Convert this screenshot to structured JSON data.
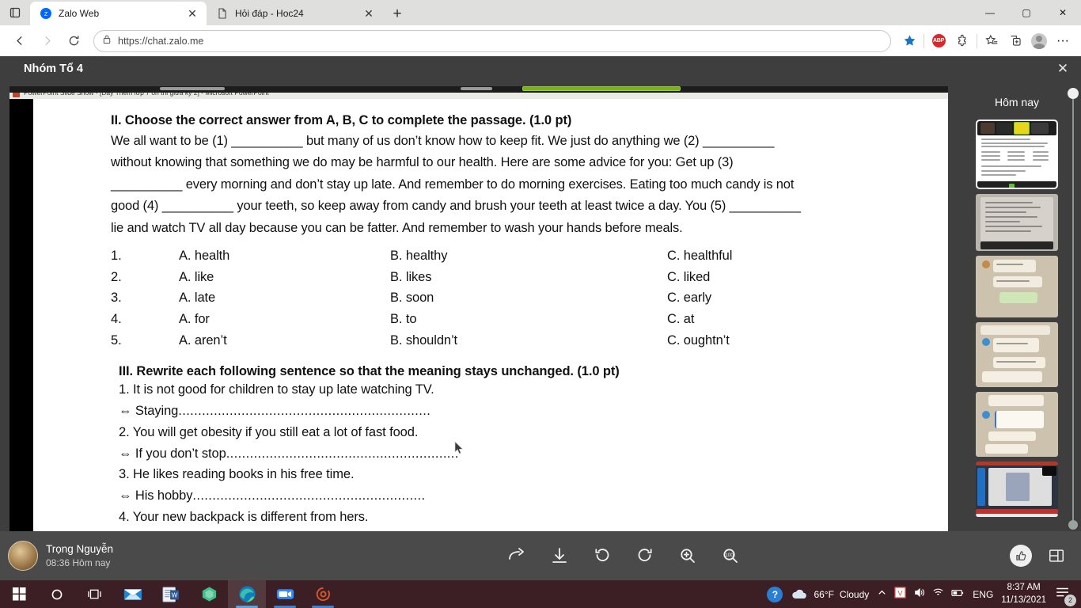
{
  "browser": {
    "tabs": [
      {
        "title": "Zalo Web",
        "favicon": "zalo-icon",
        "active": true
      },
      {
        "title": "Hỏi đáp - Hoc24",
        "favicon": "page-icon",
        "active": false
      }
    ],
    "new_tab_label": "+",
    "window_controls": {
      "minimize": "—",
      "maximize": "▢",
      "close": "✕"
    },
    "nav": {
      "back": "back-arrow",
      "forward": "forward-arrow",
      "reload": "reload-icon"
    },
    "address": {
      "url": "https://chat.zalo.me",
      "lock": "lock-icon"
    },
    "toolbar_icons": [
      "favorite-star-icon",
      "adblock-plus-icon",
      "extensions-icon",
      "collections-icon",
      "tab-collection-icon",
      "profile-avatar",
      "more-options-icon"
    ],
    "adblock_label": "ABP",
    "more_label": "···"
  },
  "viewer": {
    "title": "Nhóm Tổ 4",
    "close_label": "✕",
    "ppt_titlebar": "PowerPoint Slide Show - [Day Thêm lớp 7 ôn thi giữa kỳ 2] - Microsoft PowerPoint"
  },
  "slide": {
    "section2_heading": "II. Choose the correct answer from A, B, C to complete the passage. (1.0 pt)",
    "passage": [
      {
        "text": "We all want to be (1)",
        "blank": 100
      },
      {
        "text": "but many of us don’t know how to keep fit. We just do anything we (2)",
        "blank": 105
      },
      {
        "text": "without knowing that something we do may be harmful to our health. Here are some advice for you: Get up (3)",
        "blank": 0
      },
      {
        "text": "",
        "blank": 100
      },
      {
        "text": "every morning and don’t stay up late. And remember to do morning exercises. Eating too much candy is not good (4)",
        "blank": 95
      },
      {
        "text": "your teeth, so keep away from candy and brush your teeth at least twice a day. You (5)",
        "blank": 105
      },
      {
        "text": "lie and watch TV all day because you can be fatter. And remember to wash your hands before meals.",
        "blank": 0
      }
    ],
    "passage_lines": [
      "We all want to be (1) __________ but many of us don’t know how to keep fit. We just do anything we (2) __________",
      "without knowing that something we do may be harmful to our health. Here are some advice for you: Get up (3)",
      "__________ every morning and don’t stay up late. And remember to do morning exercises. Eating too much candy is not",
      "good (4) __________ your teeth, so keep away from candy and brush your teeth at least twice a day. You (5) __________",
      "lie and watch TV all day because you can be fatter. And remember to wash your hands before meals."
    ],
    "mc_questions": [
      {
        "num": "1.",
        "a": "A. health",
        "b": "B. healthy",
        "c": "C. healthful"
      },
      {
        "num": "2.",
        "a": "A. like",
        "b": "B. likes",
        "c": "C. liked"
      },
      {
        "num": "3.",
        "a": "A. late",
        "b": "B. soon",
        "c": "C. early"
      },
      {
        "num": "4.",
        "a": "A. for",
        "b": "B. to",
        "c": "C. at"
      },
      {
        "num": "5.",
        "a": "A. aren’t",
        "b": "B. shouldn’t",
        "c": "C. oughtn’t"
      }
    ],
    "section3_heading": "III. Rewrite each following sentence so that the meaning stays unchanged.",
    "section3_points": "(1.0 pt)",
    "rewrite_items": [
      {
        "prompt": "1. It is not good for children to stay up late watching TV.",
        "answer": "⇔ Staying",
        "dots": "................................................................"
      },
      {
        "prompt": "2. You will get obesity if you still eat a lot of fast food.",
        "answer": "⇔ If you don’t stop",
        "dots": "..........................................................."
      },
      {
        "prompt": "3. He likes reading books in his free time.",
        "answer": "⇔ His hobby",
        "dots": "..........................................................."
      },
      {
        "prompt": "4. Your new backpack is different from hers.",
        "answer": "",
        "dots": ""
      }
    ]
  },
  "sidebar": {
    "title": "Hôm nay",
    "thumbnails": [
      {
        "name": "thumbnail-meeting-slide",
        "kind": "first"
      },
      {
        "name": "thumbnail-document",
        "kind": "doc"
      },
      {
        "name": "thumbnail-chat-1",
        "kind": "chat"
      },
      {
        "name": "thumbnail-chat-2",
        "kind": "chat2"
      },
      {
        "name": "thumbnail-chat-3",
        "kind": "chat2"
      },
      {
        "name": "thumbnail-dark-screen",
        "kind": "dark"
      }
    ]
  },
  "bottom_bar": {
    "sender_name": "Trọng Nguyễn",
    "sender_time": "08:36 Hôm nay",
    "tools": [
      {
        "name": "forward-icon",
        "label": "forward"
      },
      {
        "name": "download-icon",
        "label": "download"
      },
      {
        "name": "rotate-left-icon",
        "label": "rotate left"
      },
      {
        "name": "rotate-right-icon",
        "label": "rotate right"
      },
      {
        "name": "zoom-in-icon",
        "label": "zoom in"
      },
      {
        "name": "zoom-actual-size-icon",
        "label": "actual size"
      }
    ],
    "right_tools": [
      {
        "name": "like-icon",
        "label": "like"
      },
      {
        "name": "layout-toggle-icon",
        "label": "layout"
      }
    ]
  },
  "taskbar": {
    "items": [
      {
        "name": "start-button",
        "icon": "windows-logo"
      },
      {
        "name": "search-button",
        "icon": "search-circle-icon"
      },
      {
        "name": "task-view-button",
        "icon": "task-view-icon"
      },
      {
        "name": "mail-app",
        "icon": "mail-icon"
      },
      {
        "name": "word-app",
        "icon": "word-icon"
      },
      {
        "name": "vivaldi-app",
        "icon": "vivaldi-icon"
      },
      {
        "name": "edge-browser",
        "icon": "edge-icon"
      },
      {
        "name": "zoom-app",
        "icon": "zoom-camera-icon"
      },
      {
        "name": "recorder-app",
        "icon": "recorder-icon"
      }
    ],
    "help_icon": "?",
    "weather_temp": "66°F",
    "weather_desc": "Cloudy",
    "tray": [
      "chevron-up-icon",
      "vivaldi-tray-icon",
      "volume-icon",
      "wifi-icon",
      "battery-icon"
    ],
    "language": "ENG",
    "time": "8:37 AM",
    "date": "11/13/2021",
    "notification_count": "2"
  },
  "colors": {
    "browser_chrome": "#dfdfde",
    "viewer_bg": "#3e3e3e",
    "bottom_bar": "#4a4a4a",
    "taskbar": "#3c1f25",
    "accent_blue": "#2a7fd4",
    "adblock_red": "#d9282a",
    "active_speaker_green": "#7ab317"
  }
}
